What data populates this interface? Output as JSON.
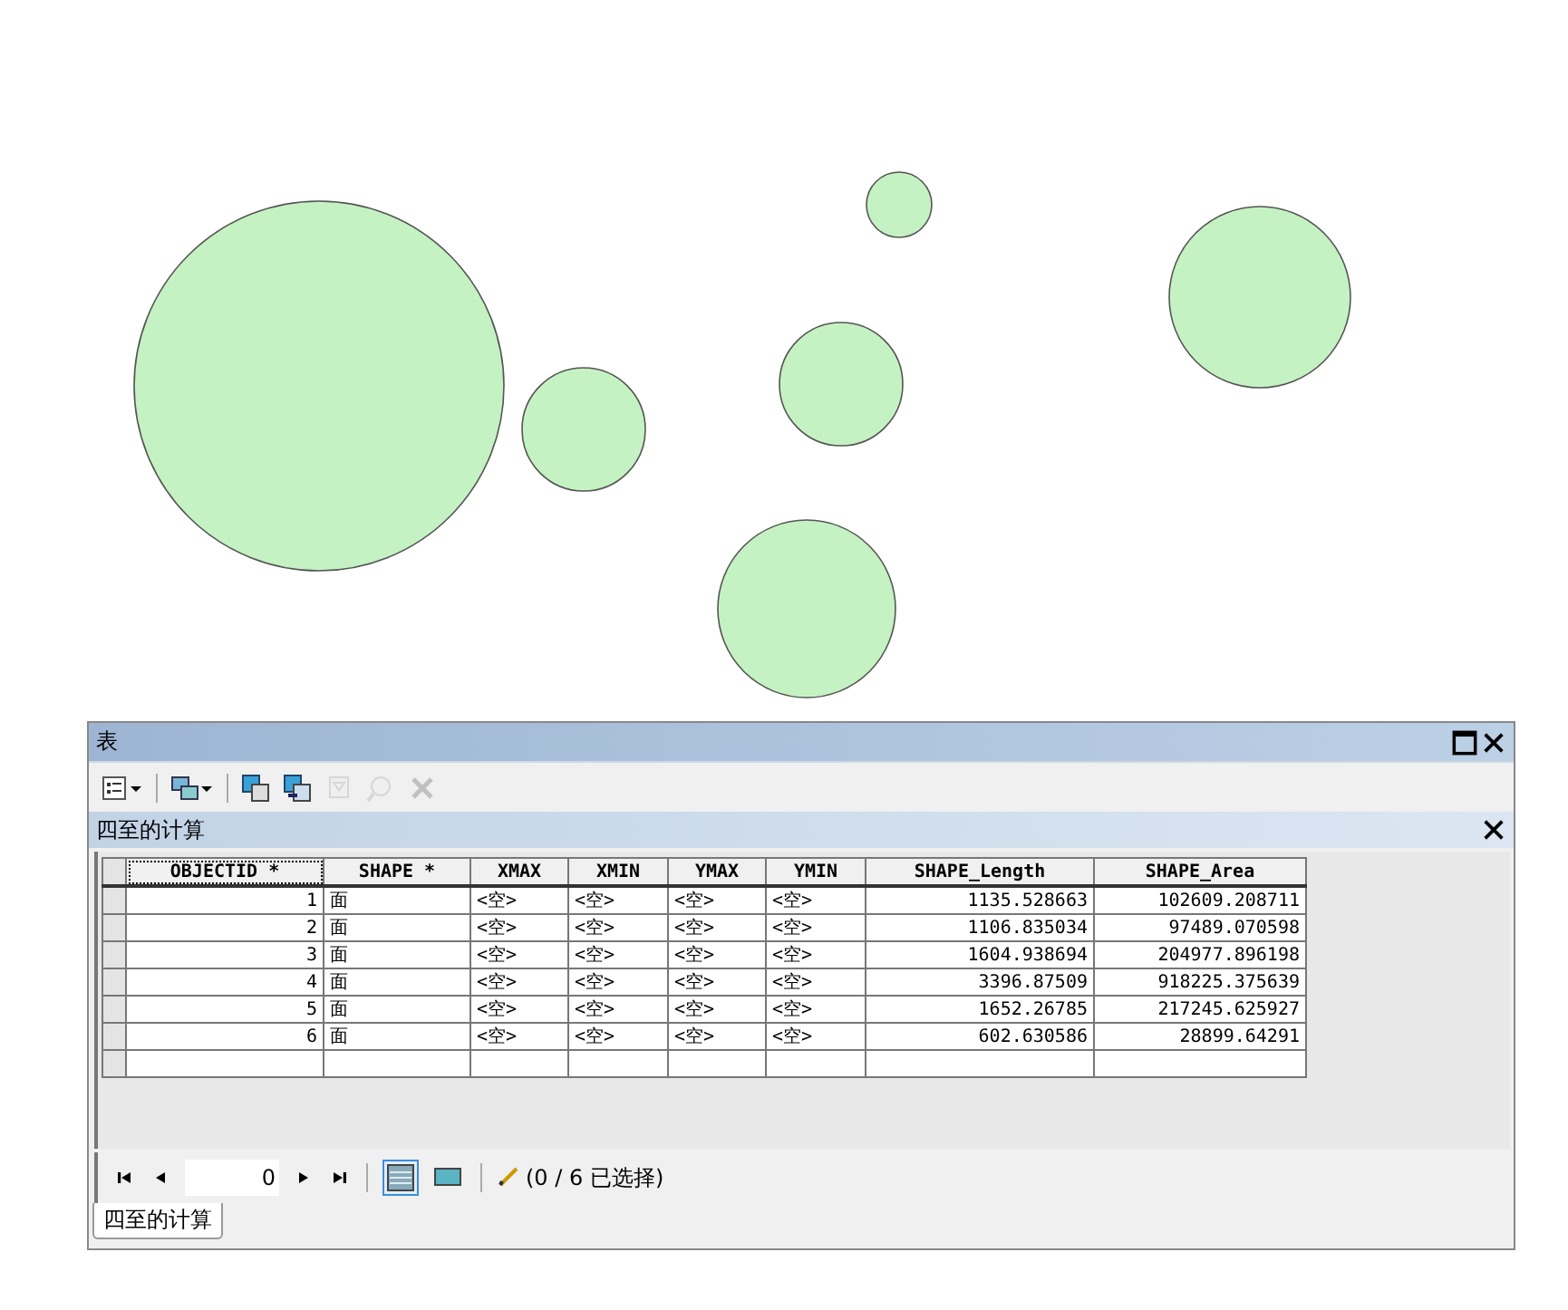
{
  "window": {
    "title": "表"
  },
  "toolbar": [
    {
      "kind": "table-options",
      "dropdown": true,
      "disabled": false
    },
    {
      "kind": "related-tables",
      "dropdown": true,
      "disabled": false
    },
    {
      "kind": "select-by-attributes",
      "dropdown": false,
      "disabled": false
    },
    {
      "kind": "switch-selection",
      "dropdown": false,
      "disabled": false
    },
    {
      "kind": "clear-selection",
      "dropdown": false,
      "disabled": true
    },
    {
      "kind": "zoom-to-selected",
      "dropdown": false,
      "disabled": true
    },
    {
      "kind": "delete-selected",
      "dropdown": false,
      "disabled": true
    }
  ],
  "table_title": "四至的计算",
  "table": {
    "columns": [
      {
        "label": "OBJECTID *",
        "kind": "number"
      },
      {
        "label": "SHAPE *",
        "kind": "text"
      },
      {
        "label": "XMAX",
        "kind": "text"
      },
      {
        "label": "XMIN",
        "kind": "text"
      },
      {
        "label": "YMAX",
        "kind": "text"
      },
      {
        "label": "YMIN",
        "kind": "text"
      },
      {
        "label": "SHAPE_Length",
        "kind": "number"
      },
      {
        "label": "SHAPE_Area",
        "kind": "number"
      }
    ],
    "rows": [
      [
        "1",
        "面",
        "<空>",
        "<空>",
        "<空>",
        "<空>",
        "1135.528663",
        "102609.208711"
      ],
      [
        "2",
        "面",
        "<空>",
        "<空>",
        "<空>",
        "<空>",
        "1106.835034",
        "97489.070598"
      ],
      [
        "3",
        "面",
        "<空>",
        "<空>",
        "<空>",
        "<空>",
        "1604.938694",
        "204977.896198"
      ],
      [
        "4",
        "面",
        "<空>",
        "<空>",
        "<空>",
        "<空>",
        "3396.87509",
        "918225.375639"
      ],
      [
        "5",
        "面",
        "<空>",
        "<空>",
        "<空>",
        "<空>",
        "1652.26785",
        "217245.625927"
      ],
      [
        "6",
        "面",
        "<空>",
        "<空>",
        "<空>",
        "<空>",
        "602.630586",
        "28899.64291"
      ]
    ]
  },
  "navigator": {
    "record": "0",
    "views": [
      {
        "kind": "all-records",
        "selected": true
      },
      {
        "kind": "selected-records",
        "selected": false
      }
    ],
    "selection": "(0 / 6 已选择)"
  },
  "tabs": [
    {
      "label": "四至的计算",
      "selected": true
    }
  ]
}
